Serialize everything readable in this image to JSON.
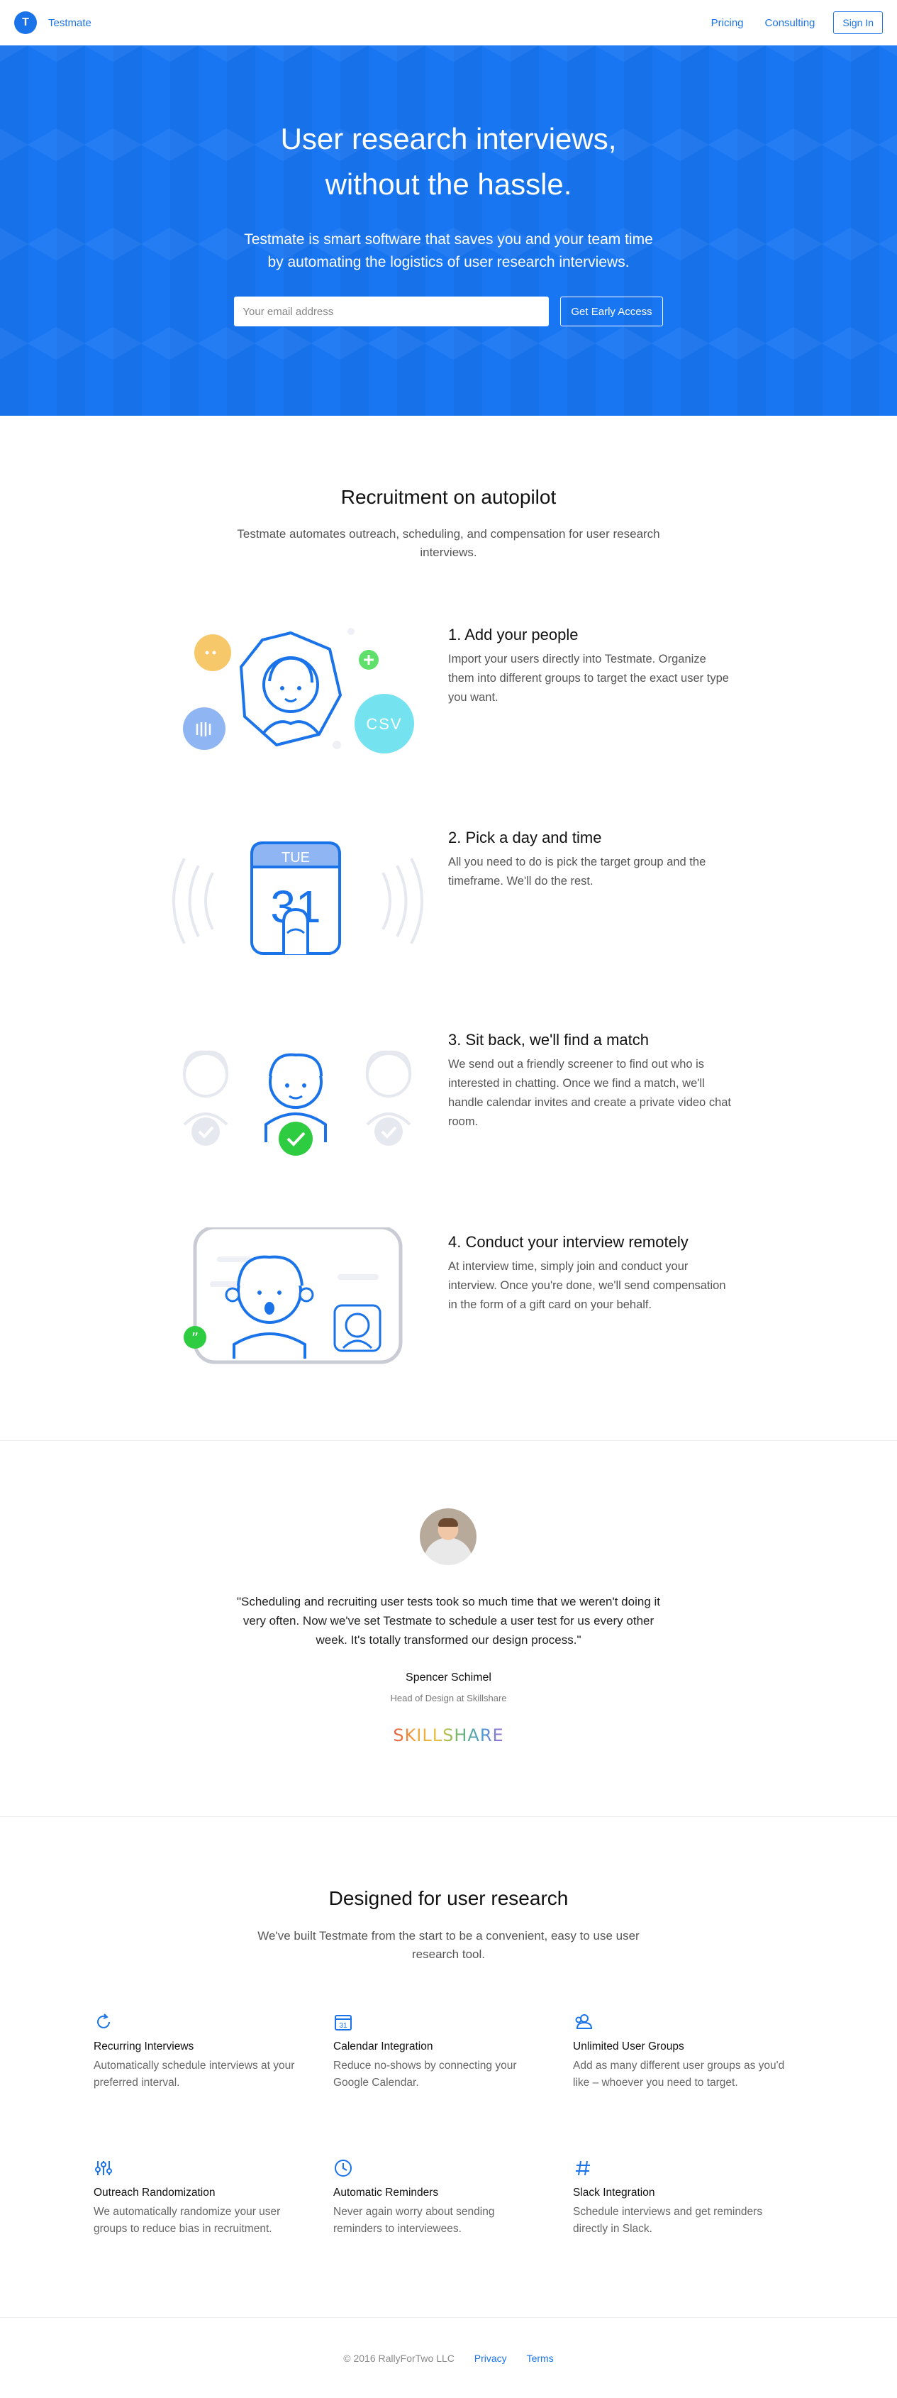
{
  "header": {
    "logo_letter": "T",
    "app_name": "Testmate",
    "links": [
      "Pricing",
      "Consulting"
    ],
    "signin_label": "Sign In"
  },
  "hero": {
    "title_line1": "User research interviews,",
    "title_line2": "without the hassle.",
    "subtitle_line1": "Testmate is smart software that saves you and your team time",
    "subtitle_line2": "by automating the logistics of user research interviews.",
    "email_placeholder": "Your email address",
    "cta_label": "Get Early Access"
  },
  "recruitment": {
    "title": "Recruitment on autopilot",
    "subtitle": "Testmate automates outreach, scheduling, and compensation for user research interviews.",
    "steps": [
      {
        "title": "1. Add your people",
        "text": "Import your users directly into Testmate. Organize them into different groups to target the exact user type you want.",
        "art_csv": "CSV"
      },
      {
        "title": "2. Pick a day and time",
        "text": "All you need to do is pick the target group and the timeframe. We'll do the rest.",
        "art_day": "TUE",
        "art_date": "31"
      },
      {
        "title": "3. Sit back, we'll find a match",
        "text": "We send out a friendly screener to find out who is interested in chatting. Once we find a match, we'll handle calendar invites and create a private video chat room."
      },
      {
        "title": "4. Conduct your interview remotely",
        "text": "At interview time, simply join and conduct your interview. Once you're done, we'll send compensation in the form of a gift card on your behalf."
      }
    ]
  },
  "testimonial": {
    "quote": "\"Scheduling and recruiting user tests took so much time that we weren't doing it very often. Now we've set Testmate to schedule a user test for us every other week. It's totally transformed our design process.\"",
    "name": "Spencer Schimel",
    "role": "Head of Design at Skillshare",
    "logo": "SKILLSHARE"
  },
  "features": {
    "title": "Designed for user research",
    "subtitle": "We've built Testmate from the start to be a convenient, easy to use user research tool.",
    "items": [
      {
        "icon": "refresh-icon",
        "title": "Recurring Interviews",
        "text": "Automatically schedule interviews at your preferred interval."
      },
      {
        "icon": "calendar-icon",
        "icon_text": "31",
        "title": "Calendar Integration",
        "text": "Reduce no-shows by connecting your Google Calendar."
      },
      {
        "icon": "user-groups-icon",
        "title": "Unlimited User Groups",
        "text": "Add as many different user groups as you'd like – whoever you need to target."
      },
      {
        "icon": "sliders-icon",
        "title": "Outreach Randomization",
        "text": "We automatically randomize your user groups to reduce bias in recruitment."
      },
      {
        "icon": "clock-icon",
        "title": "Automatic Reminders",
        "text": "Never again worry about sending reminders to interviewees."
      },
      {
        "icon": "hash-icon",
        "title": "Slack Integration",
        "text": "Schedule interviews and get reminders directly in Slack."
      }
    ]
  },
  "footer": {
    "copyright": "© 2016 RallyForTwo LLC",
    "links": [
      "Privacy",
      "Terms"
    ]
  },
  "colors": {
    "brand": "#1876f2",
    "link": "#1a73e8",
    "success": "#2ecc40"
  }
}
